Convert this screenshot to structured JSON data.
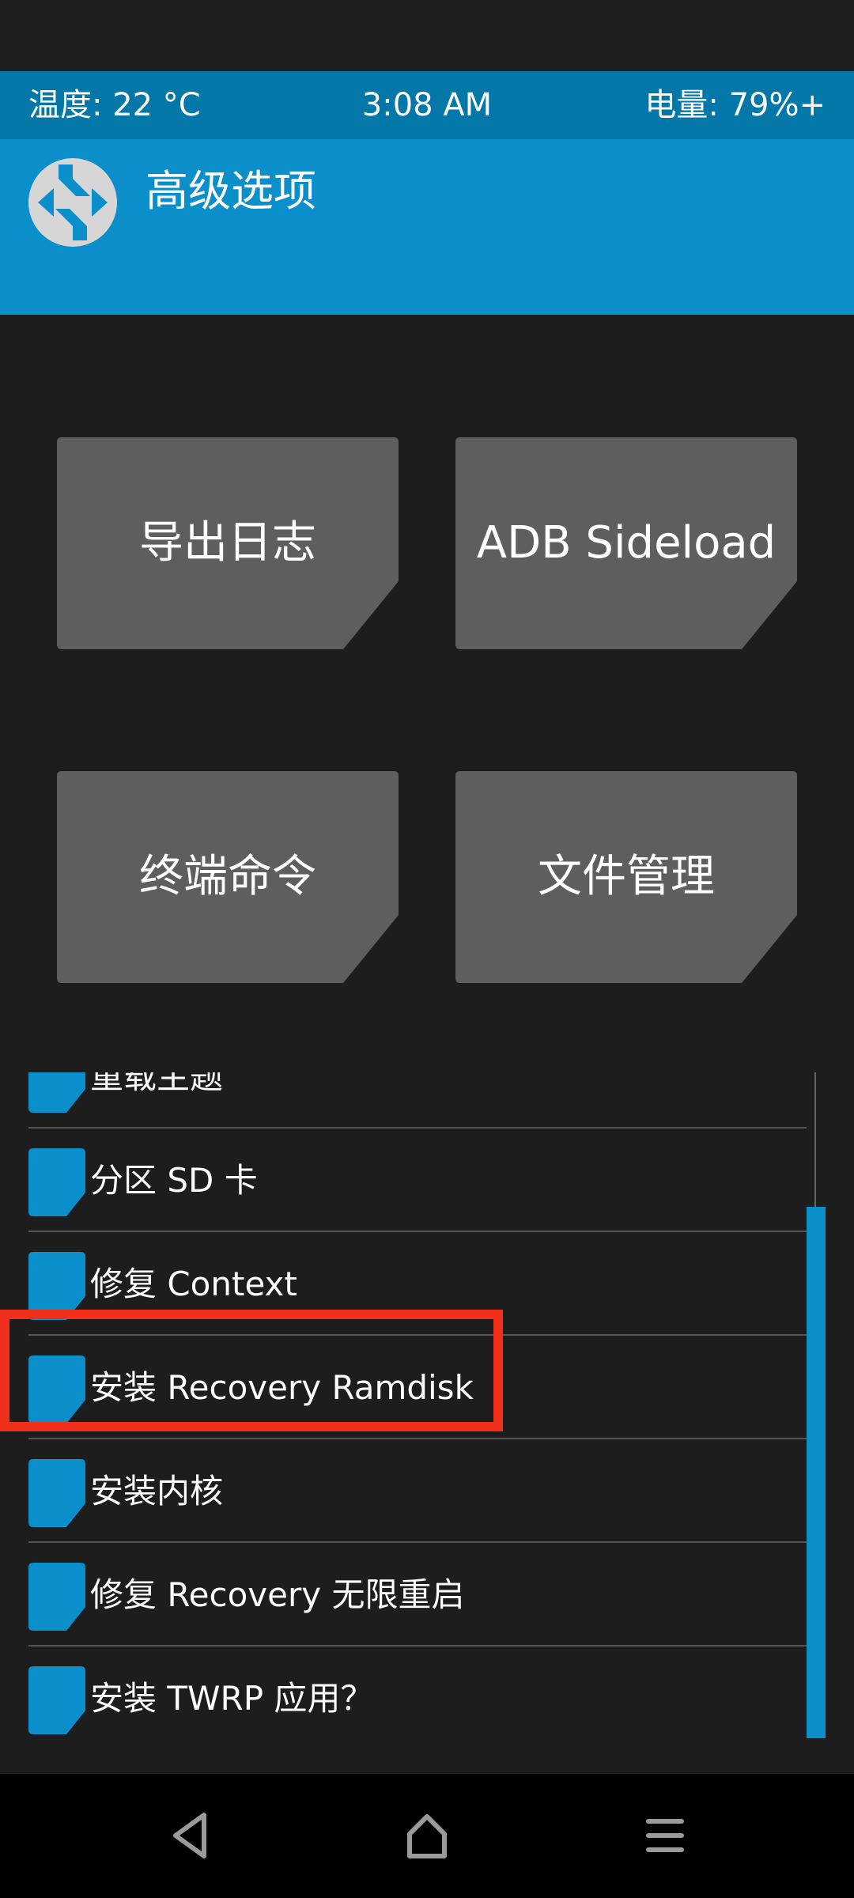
{
  "status_bar": {
    "temperature": "温度: 22 °C",
    "time": "3:08 AM",
    "battery": "电量: 79%+"
  },
  "header": {
    "title": "高级选项",
    "logo_icon": "twrp-logo-icon"
  },
  "tiles": [
    {
      "label": "导出日志"
    },
    {
      "label": "ADB Sideload"
    },
    {
      "label": "终端命令"
    },
    {
      "label": "文件管理"
    }
  ],
  "list": {
    "items": [
      {
        "label": "重载主题"
      },
      {
        "label": "分区 SD 卡"
      },
      {
        "label": "修复 Context"
      },
      {
        "label": "安装 Recovery Ramdisk"
      },
      {
        "label": "安装内核"
      },
      {
        "label": "修复 Recovery 无限重启"
      },
      {
        "label": "安装 TWRP 应用？"
      }
    ]
  },
  "nav": {
    "back_icon": "back-triangle-icon",
    "home_icon": "home-icon",
    "menu_icon": "menu-lines-icon"
  },
  "colors": {
    "accent": "#0b8fcb",
    "status_bar": "#0277a8",
    "background": "#1d1d1d",
    "tile": "#5e5e5e",
    "highlight": "#f0301b"
  }
}
